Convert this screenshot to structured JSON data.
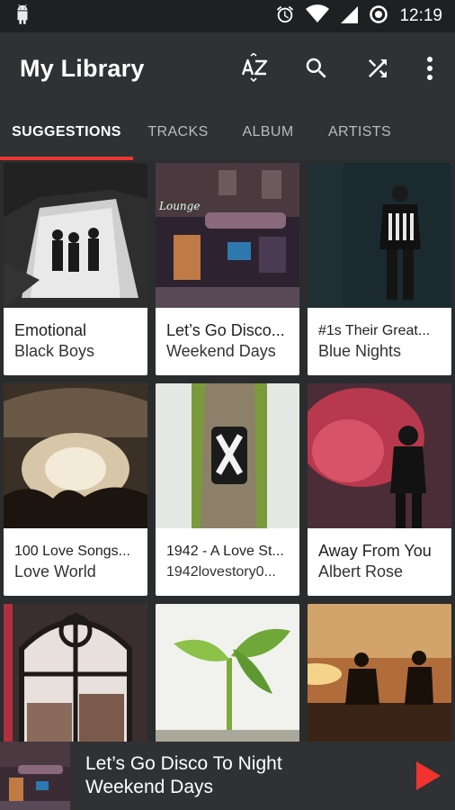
{
  "status_bar": {
    "time": "12:19"
  },
  "app_bar": {
    "title": "My Library"
  },
  "tabs": [
    {
      "label": "SUGGESTIONS",
      "active": true
    },
    {
      "label": "TRACKS"
    },
    {
      "label": "ALBUM"
    },
    {
      "label": "ARTISTS"
    }
  ],
  "cards": [
    {
      "line1": "Emotional",
      "line2": "Black Boys"
    },
    {
      "line1": "Let’s Go Disco...",
      "line2": "Weekend Days"
    },
    {
      "line1": "#1s Their Great...",
      "line2": "Blue Nights"
    },
    {
      "line1": "100 Love Songs...",
      "line2": "Love World"
    },
    {
      "line1": "1942 - A Love St...",
      "line2": "1942lovestory0..."
    },
    {
      "line1": "Away From You",
      "line2": "Albert Rose"
    }
  ],
  "now_playing": {
    "title": "Let’s Go Disco To Night",
    "subtitle": "Weekend Days"
  },
  "colors": {
    "accent": "#e53935",
    "app_bg": "#2f3133",
    "status_bg": "#1e2021",
    "card_bg": "#ffffff"
  }
}
